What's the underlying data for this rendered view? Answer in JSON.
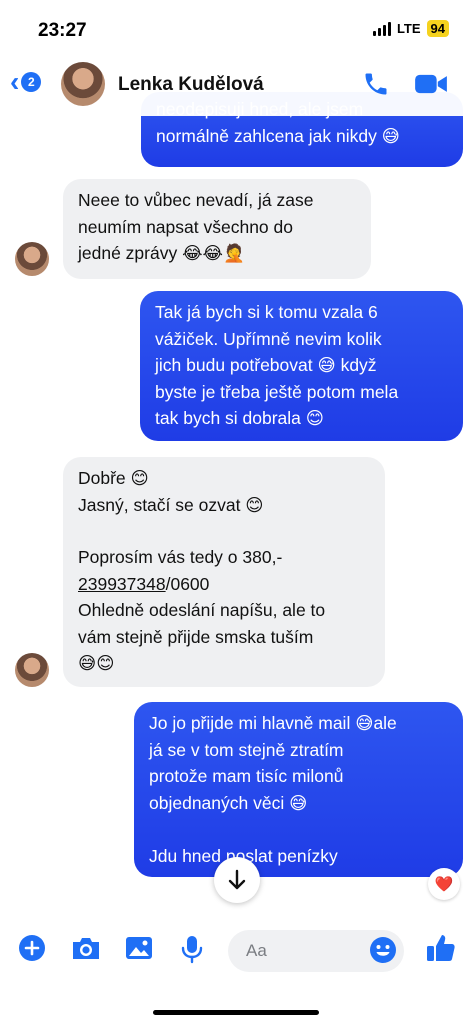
{
  "status": {
    "time": "23:27",
    "network": "LTE",
    "battery": "94"
  },
  "header": {
    "back_count": "2",
    "contact_name": "Lenka Kudělová"
  },
  "messages": [
    {
      "dir": "out",
      "text": "neodepisuji hned, ale jsem\nnormálně zahlcena jak nikdy 😅"
    },
    {
      "dir": "in",
      "text": "Neee to vůbec nevadí, já zase\nneumím napsat všechno do\njedné zprávy 😂😂🤦"
    },
    {
      "dir": "out",
      "text": "Tak já bych si k tomu vzala 6\nvážiček. Upřímně nevim kolik\njich budu potřebovat 😅 když\nbyste je třeba ještě potom mela\ntak bych si dobrala 😊"
    },
    {
      "dir": "in",
      "line1": "Dobře 😊",
      "line2": "Jasný, stačí se ozvat 😊",
      "line3": "Poprosím vás tedy o 380,-",
      "account": "239937348",
      "account_suffix": "/0600",
      "line5": "Ohledně odeslání napíšu, ale to\nvám stejně přijde smska tuším\n😅😊"
    },
    {
      "dir": "out",
      "text": "Jo jo přijde mi hlavně mail 😅ale\njá se v tom stejně ztratím\nprotože mam tisíc milonů\nobjednaných věci 😅\n\nJdu hned poslat penízky",
      "reaction": "❤️"
    }
  ],
  "composer": {
    "placeholder": "Aa"
  },
  "colors": {
    "accent": "#1f6ff5",
    "outgoing": "#2448ec",
    "incoming": "#eff0f2"
  }
}
